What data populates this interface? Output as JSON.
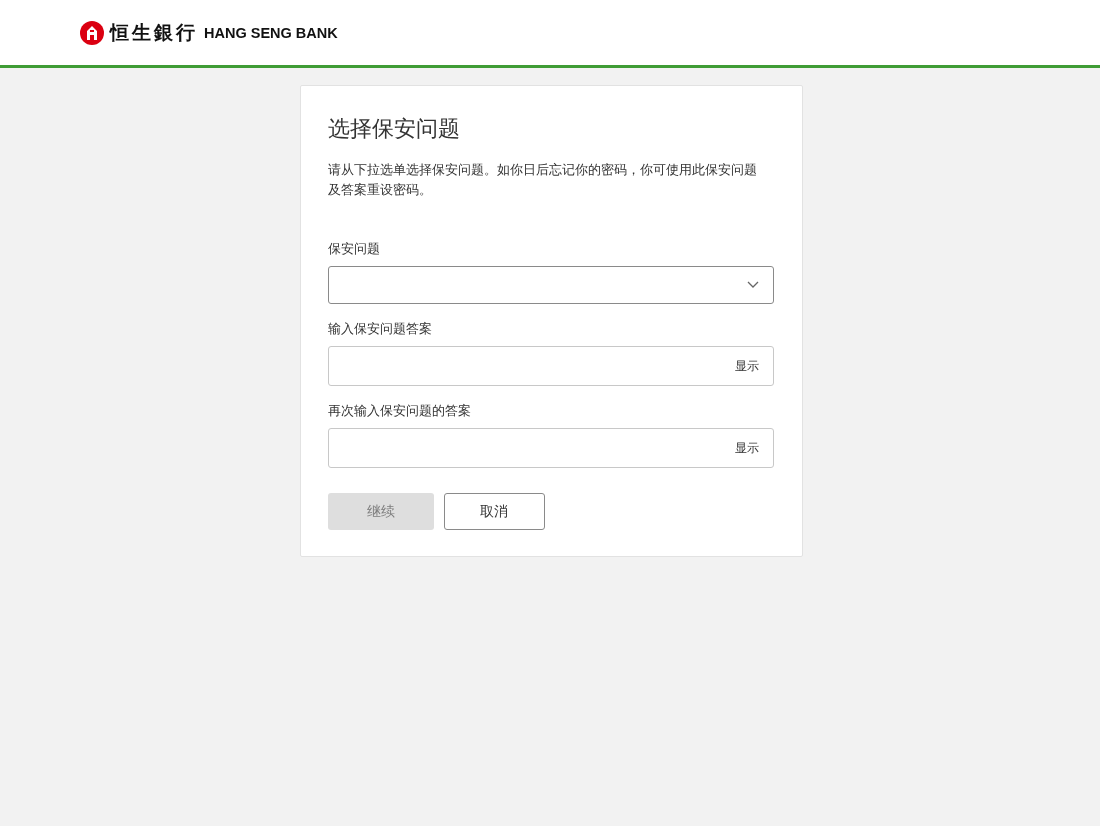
{
  "header": {
    "logo_chinese": "恒生銀行",
    "logo_english": "HANG SENG BANK"
  },
  "form": {
    "title": "选择保安问题",
    "description": "请从下拉选单选择保安问题。如你日后忘记你的密码，你可使用此保安问题及答案重设密码。",
    "fields": [
      {
        "kind": "dropdown",
        "label": "保安问题"
      },
      {
        "kind": "password",
        "label": "输入保安问题答案",
        "toggle": "显示"
      },
      {
        "kind": "password",
        "label": "再次输入保安问题的答案",
        "toggle": "显示"
      }
    ],
    "buttons": [
      {
        "label": "继续",
        "kind": "primary",
        "disabled": true
      },
      {
        "label": "取消",
        "kind": "secondary",
        "disabled": false
      }
    ]
  }
}
